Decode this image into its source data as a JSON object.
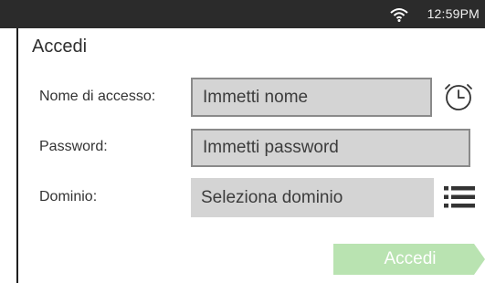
{
  "status_bar": {
    "time": "12:59PM",
    "wifi_icon": "wifi-icon"
  },
  "page": {
    "title": "Accedi"
  },
  "form": {
    "username": {
      "label": "Nome di accesso:",
      "placeholder": "Immetti nome",
      "icon": "history-clock-icon"
    },
    "password": {
      "label": "Password:",
      "placeholder": "Immetti password"
    },
    "domain": {
      "label": "Dominio:",
      "placeholder": "Seleziona dominio",
      "icon": "list-menu-icon"
    }
  },
  "actions": {
    "login_label": "Accedi"
  },
  "colors": {
    "status_bar_bg": "#2b2b2b",
    "field_bg": "#d4d4d4",
    "field_border": "#8a8a8a",
    "login_button_bg": "#b9e3b1"
  }
}
